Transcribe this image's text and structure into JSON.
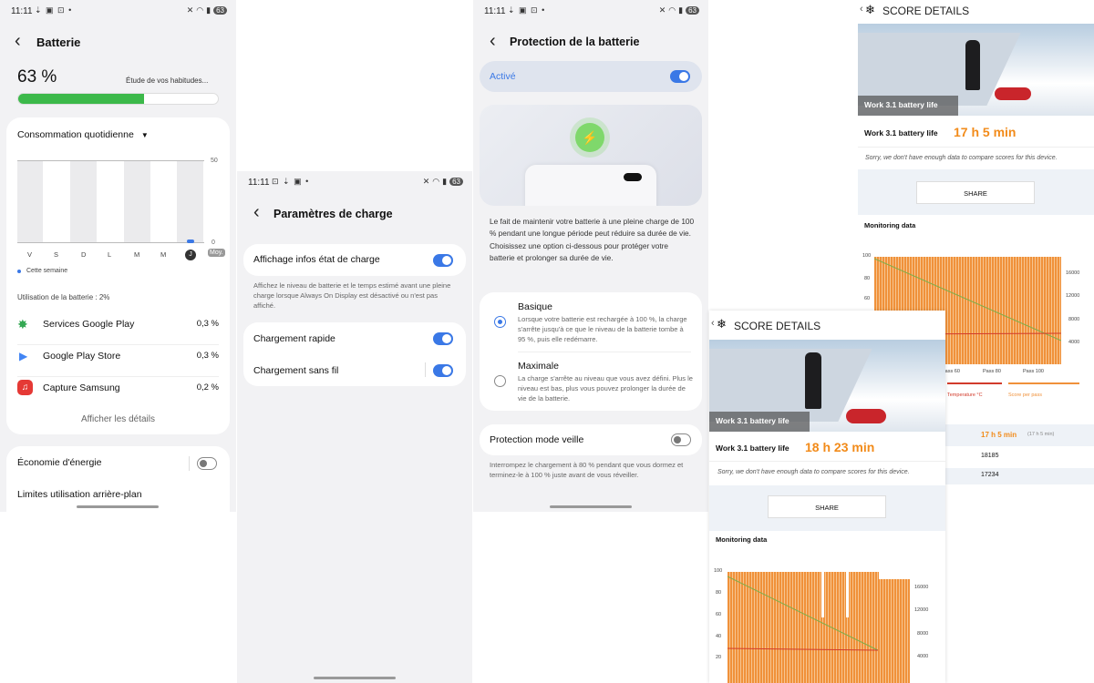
{
  "panel1": {
    "status_time": "11:11",
    "status_batt": "63",
    "title": "Batterie",
    "percent": "63 %",
    "estimate": "Étude de vos habitudes...",
    "level": 0.63,
    "daily_label": "Consommation quotidienne",
    "chart_axis_top": "50",
    "chart_axis_bottom": "0",
    "days": [
      "V",
      "S",
      "D",
      "L",
      "M",
      "M",
      "J"
    ],
    "moy": "Moy.",
    "legend": "Cette semaine",
    "usage_label": "Utilisation de la batterie : 2%",
    "apps": [
      {
        "name": "Services Google Play",
        "pct": "0,3 %"
      },
      {
        "name": "Google Play Store",
        "pct": "0,3 %"
      },
      {
        "name": "Capture Samsung",
        "pct": "0,2 %"
      }
    ],
    "details": "Afficher les détails",
    "eco": "Économie d'énergie",
    "limits": "Limites utilisation arrière-plan"
  },
  "panel2": {
    "status_time": "11:11",
    "status_batt": "63",
    "title": "Paramètres de charge",
    "item1": "Affichage infos état de charge",
    "item1_desc": "Affichez le niveau de batterie et le temps estimé avant une pleine charge lorsque Always On Display est désactivé ou n'est pas affiché.",
    "item2": "Chargement rapide",
    "item3": "Chargement sans fil"
  },
  "panel3": {
    "status_time": "11:11",
    "status_batt": "63",
    "title": "Protection de la batterie",
    "active": "Activé",
    "intro": "Le fait de maintenir votre batterie à une pleine charge de 100 % pendant une longue période peut réduire sa durée de vie. Choisissez une option ci-dessous pour protéger votre batterie et prolonger sa durée de vie.",
    "opt1_title": "Basique",
    "opt1_desc": "Lorsque votre batterie est rechargée à 100 %, la charge s'arrête jusqu'à ce que le niveau de la batterie tombe à 95 %, puis elle redémarre.",
    "opt2_title": "Maximale",
    "opt2_desc": "La charge s'arrête au niveau que vous avez défini. Plus le niveau est bas, plus vous pouvez prolonger la durée de vie de la batterie.",
    "sleep_title": "Protection mode veille",
    "sleep_desc": "Interrompez le chargement à 80 % pendant que vous dormez et terminez-le à 100 % juste avant de vous réveiller."
  },
  "score_back": {
    "header": "SCORE DETAILS",
    "image_caption": "Work 3.1 battery life",
    "label": "Work 3.1 battery life",
    "value": "17 h 5 min",
    "sorry": "Sorry, we don't have enough data to compare scores for this device.",
    "share": "SHARE",
    "monitoring": "Monitoring data",
    "left_ticks": [
      "100",
      "80",
      "60"
    ],
    "right_ticks": [
      "16000",
      "12000",
      "8000",
      "4000"
    ],
    "x_ticks": [
      "Pass 60",
      "Pass 80",
      "Pass 100"
    ],
    "legend1": "Temperature °C",
    "legend2": "Score per pass",
    "row_values": [
      "17 h 5 min",
      "(17 h 5 min)",
      "18185",
      "17234"
    ]
  },
  "score_front": {
    "header": "SCORE DETAILS",
    "image_caption": "Work 3.1 battery life",
    "label": "Work 3.1 battery life",
    "value": "18 h 23 min",
    "sorry": "Sorry, we don't have enough data to compare scores for this device.",
    "share": "SHARE",
    "monitoring": "Monitoring data",
    "left_ticks": [
      "100",
      "80",
      "60",
      "40",
      "20"
    ],
    "right_ticks": [
      "16000",
      "12000",
      "8000",
      "4000"
    ]
  },
  "colors": {
    "accent": "#3a78e6",
    "battery_green": "#3cb94a",
    "orange": "#f28b1a",
    "chart_orange": "#f0913a"
  }
}
